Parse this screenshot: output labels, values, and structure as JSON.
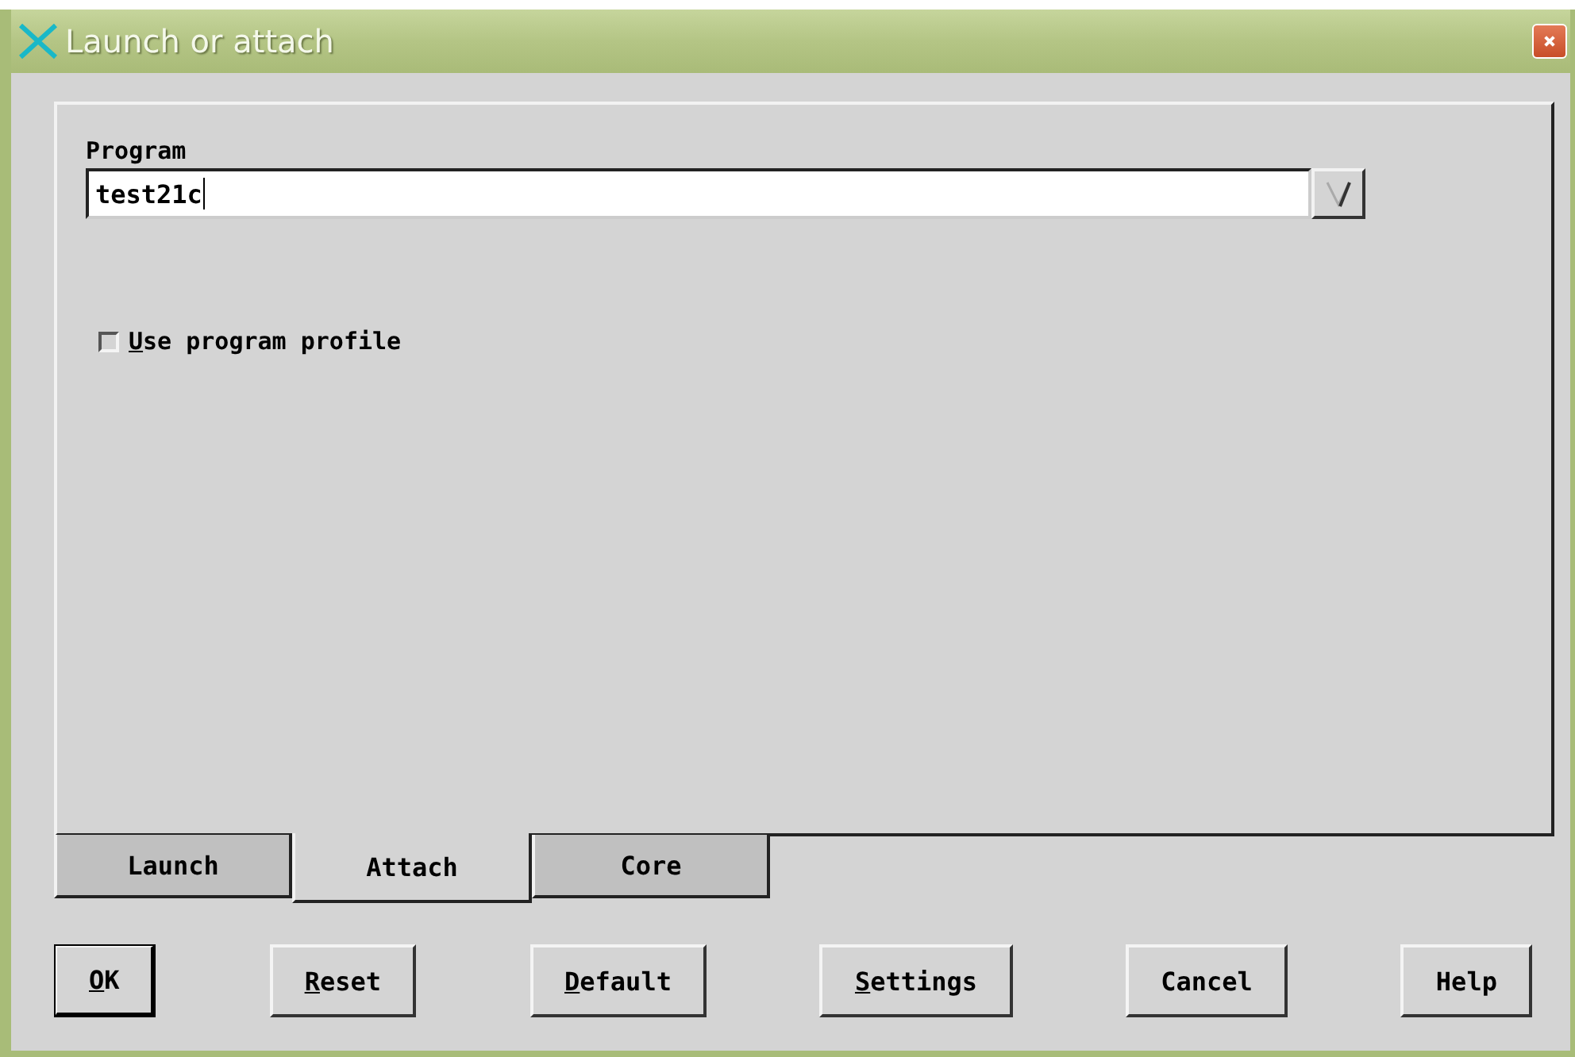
{
  "window": {
    "title": "Launch or attach"
  },
  "program": {
    "label": "Program",
    "value": "test21c"
  },
  "use_profile": {
    "label": "Use program profile",
    "checked": false,
    "mnemonic": true
  },
  "tabs": [
    {
      "label": "Launch",
      "selected": false
    },
    {
      "label": "Attach",
      "selected": true
    },
    {
      "label": "Core",
      "selected": false
    }
  ],
  "buttons": [
    {
      "label": "OK",
      "mnemonic": true,
      "default": true
    },
    {
      "label": "Reset",
      "mnemonic": true,
      "default": false
    },
    {
      "label": "Default",
      "mnemonic": true,
      "default": false
    },
    {
      "label": "Settings",
      "mnemonic": true,
      "default": false
    },
    {
      "label": "Cancel",
      "mnemonic": false,
      "default": false
    },
    {
      "label": "Help",
      "mnemonic": false,
      "default": false
    }
  ]
}
